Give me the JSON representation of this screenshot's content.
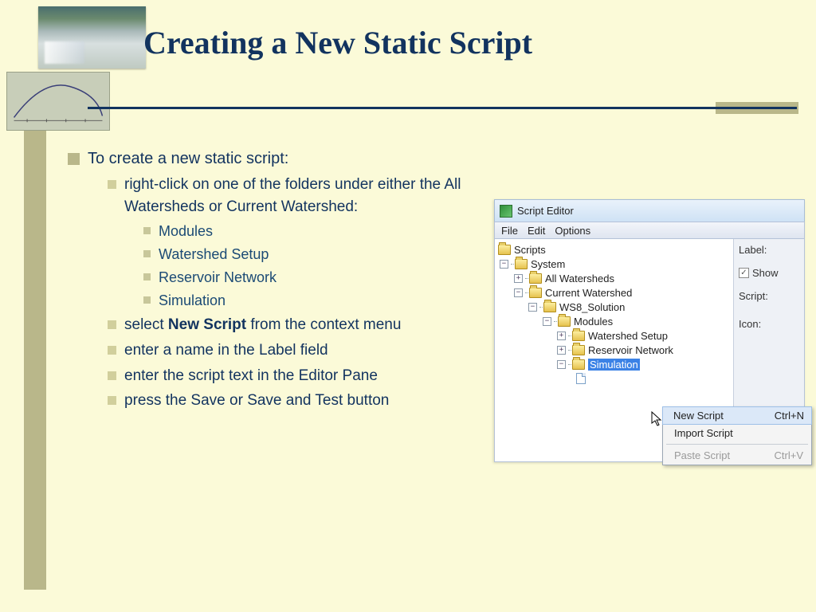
{
  "slide": {
    "title": "Creating a New Static Script",
    "bullet_intro": "To create a new static script:",
    "steps": {
      "rightclick": "right-click on one of the folders under either the All Watersheds or Current Watershed:",
      "folders": [
        "Modules",
        "Watershed Setup",
        "Reservoir Network",
        "Simulation"
      ],
      "select_pre": "select ",
      "select_bold": "New Script",
      "select_post": " from the context menu",
      "enter_label": "enter a name in the Label field",
      "enter_script": "enter the script text in the Editor Pane",
      "press_save": "press the Save or Save and Test button"
    }
  },
  "editor": {
    "window_title": "Script Editor",
    "menus": [
      "File",
      "Edit",
      "Options"
    ],
    "tree": {
      "root": "Scripts",
      "system": "System",
      "all_ws": "All Watersheds",
      "cur_ws": "Current Watershed",
      "solution": "WS8_Solution",
      "modules": "Modules",
      "ws_setup": "Watershed Setup",
      "res_net": "Reservoir Network",
      "simulation": "Simulation"
    },
    "right": {
      "label": "Label:",
      "show": "Show",
      "script": "Script:",
      "icon": "Icon:"
    },
    "context_menu": {
      "new_script": "New Script",
      "new_shortcut": "Ctrl+N",
      "import": "Import Script",
      "paste": "Paste Script",
      "paste_shortcut": "Ctrl+V"
    }
  }
}
